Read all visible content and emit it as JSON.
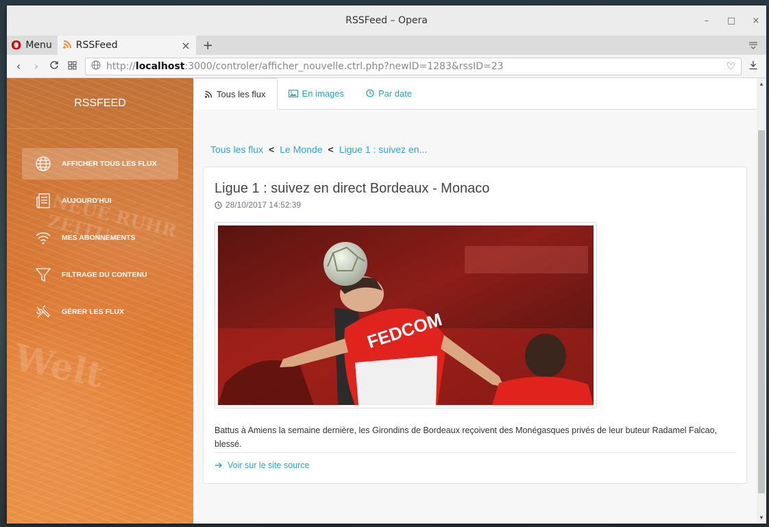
{
  "window": {
    "title": "RSSFeed – Opera",
    "controls": [
      "–",
      "□",
      "×"
    ]
  },
  "browser": {
    "menu_label": "Menu",
    "tab_title": "RSSFeed",
    "tab_close": "×",
    "new_tab": "+",
    "url_prefix": "http://",
    "url_host": "localhost",
    "url_rest": ":3000/controler/afficher_nouvelle.ctrl.php?newID=1283&rssID=23"
  },
  "sidebar": {
    "brand": "RSSFEED",
    "items": [
      {
        "label": "AFFICHER TOUS LES FLUX",
        "icon": "globe-icon",
        "active": true
      },
      {
        "label": "AUJOURD'HUI",
        "icon": "newspaper-icon",
        "active": false
      },
      {
        "label": "MES ABONNEMENTS",
        "icon": "wifi-icon",
        "active": false
      },
      {
        "label": "FILTRAGE DU CONTENU",
        "icon": "filter-icon",
        "active": false
      },
      {
        "label": "GÉRER LES FLUX",
        "icon": "tools-icon",
        "active": false
      }
    ]
  },
  "tabs": [
    {
      "label": "Tous les flux",
      "icon": "rss-icon",
      "active": true
    },
    {
      "label": "En images",
      "icon": "image-icon",
      "active": false
    },
    {
      "label": "Par date",
      "icon": "clock-icon",
      "active": false
    }
  ],
  "breadcrumb": {
    "items": [
      "Tous les flux",
      "Le Monde",
      "Ligue 1 : suivez en..."
    ],
    "separator": "<"
  },
  "article": {
    "title": "Ligue 1 : suivez en direct Bordeaux - Monaco",
    "date": "28/10/2017 14:52:39",
    "image_alt": "Football player heading a ball",
    "jersey_text": "FEDCOM",
    "description": "Battus à Amiens la semaine dernière, les Girondins de Bordeaux reçoivent des Monégasques privés de leur buteur Radamel Falcao, blessé.",
    "source_link": "Voir sur le site source"
  },
  "colors": {
    "accent": "#2ea6cf",
    "sidebar": "#e07a33",
    "opera_red": "#dd0000"
  }
}
